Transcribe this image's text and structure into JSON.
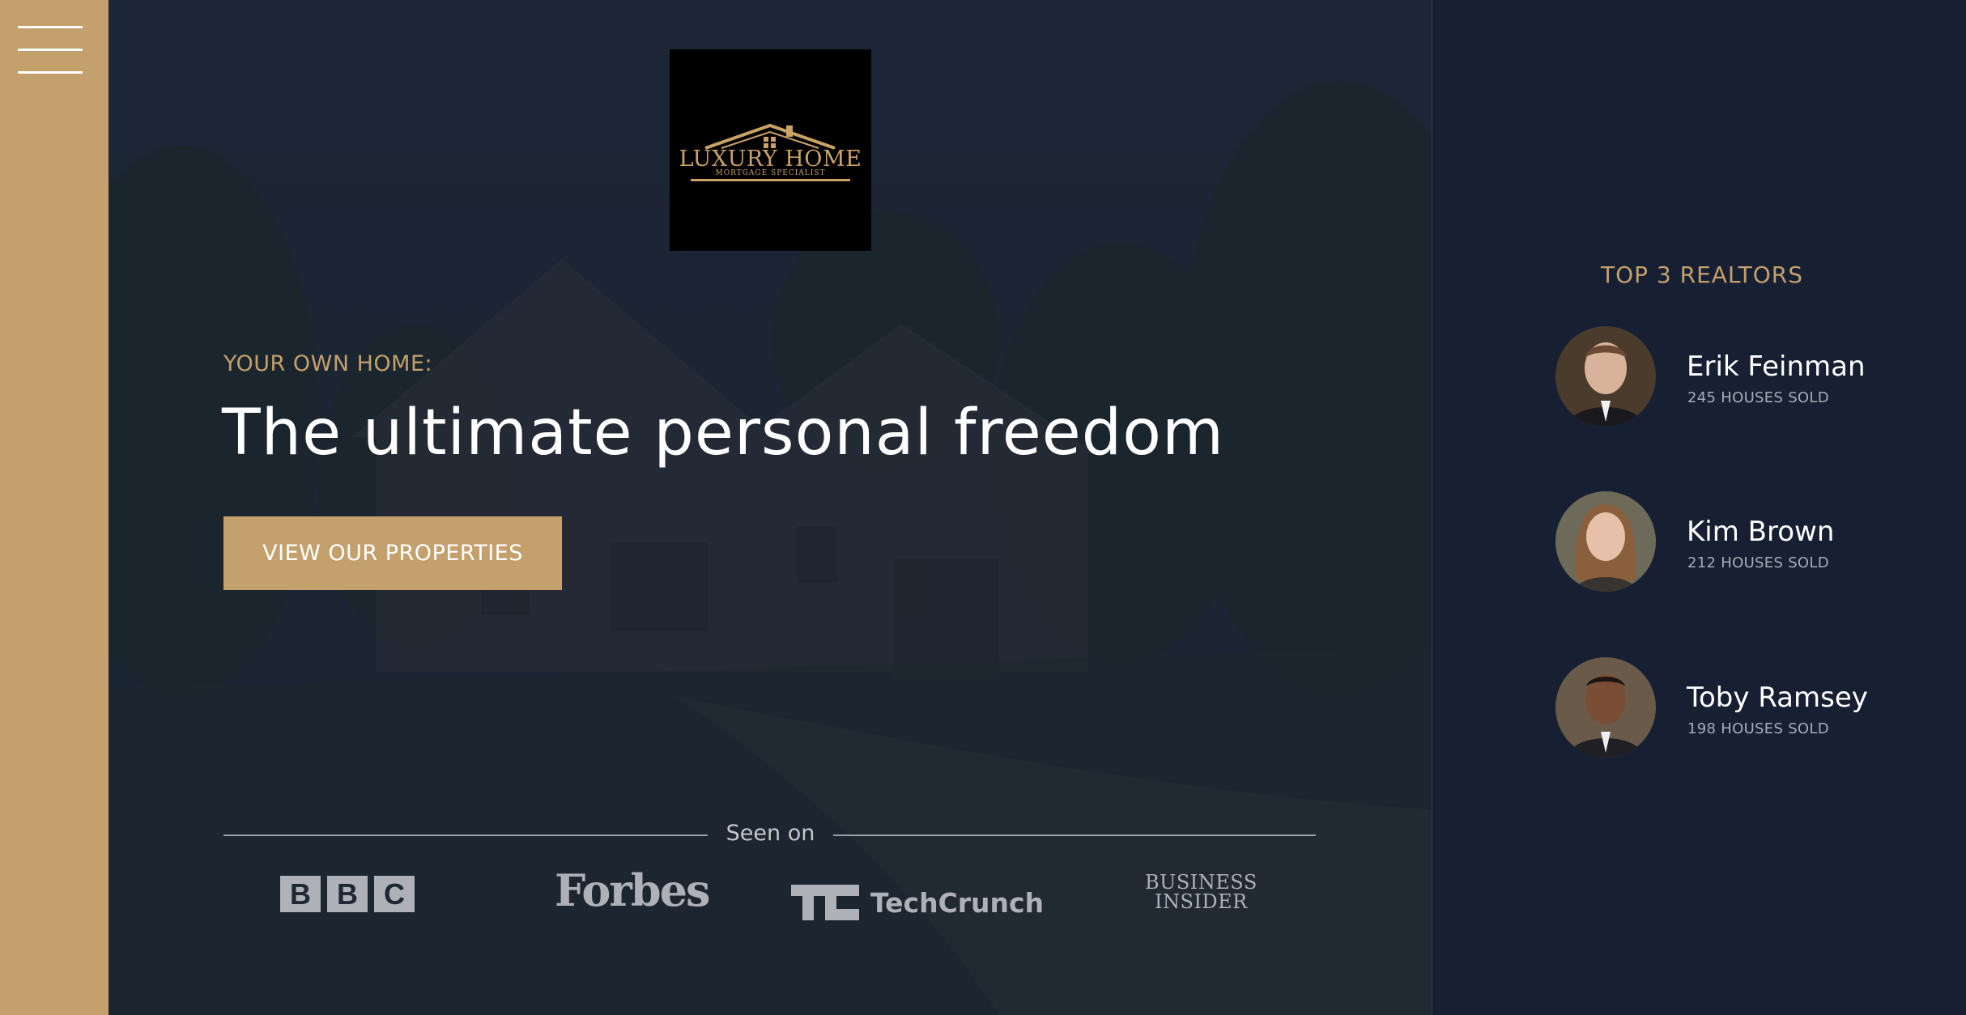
{
  "colors": {
    "accent_gold": "#c4a06c",
    "panel_bg": "#172033",
    "hero_bg": "#222a3a",
    "text_white": "#ffffff"
  },
  "nav": {
    "menu_icon": "hamburger-menu-icon"
  },
  "logo": {
    "title": "LUXURY HOME",
    "subtitle": "MORTGAGE SPECIALIST"
  },
  "hero": {
    "eyebrow": "YOUR OWN HOME:",
    "headline": "The ultimate personal freedom",
    "cta_label": "VIEW OUR PROPERTIES"
  },
  "press": {
    "label": "Seen on",
    "bbc": [
      "B",
      "B",
      "C"
    ],
    "forbes": "Forbes",
    "techcrunch": "TechCrunch",
    "business_insider_line1": "BUSINESS",
    "business_insider_line2": "INSIDER"
  },
  "realtors": {
    "title": "TOP 3 REALTORS",
    "items": [
      {
        "name": "Erik Feinman",
        "sold": "245 HOUSES SOLD"
      },
      {
        "name": "Kim Brown",
        "sold": "212 HOUSES SOLD"
      },
      {
        "name": "Toby Ramsey",
        "sold": "198 HOUSES SOLD"
      }
    ]
  }
}
